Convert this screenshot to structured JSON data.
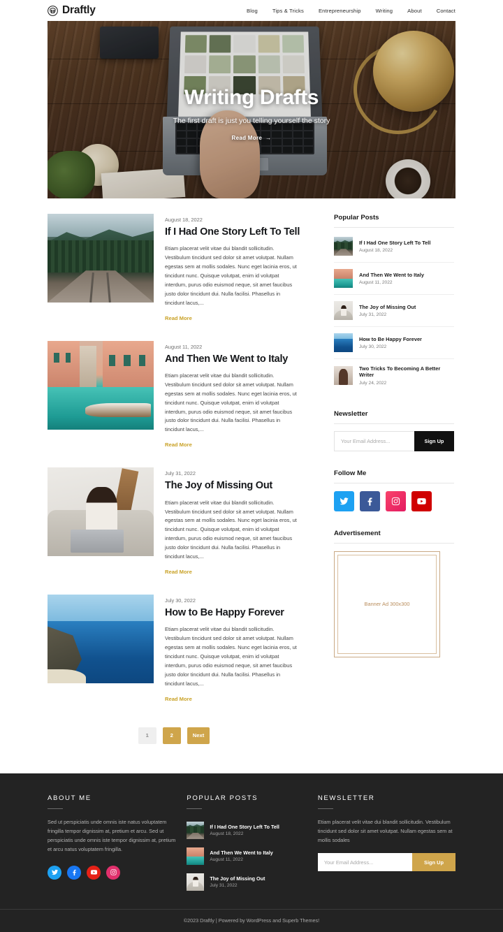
{
  "header": {
    "brand": "Draftly",
    "logo_icon": "shell-crown-circle-icon",
    "nav": [
      {
        "label": "Blog"
      },
      {
        "label": "Tips & Tricks"
      },
      {
        "label": "Entrepreneurship"
      },
      {
        "label": "Writing"
      },
      {
        "label": "About"
      },
      {
        "label": "Contact"
      }
    ]
  },
  "hero": {
    "title": "Writing Drafts",
    "subtitle": "The first draft is just you telling yourself the story",
    "cta": "Read More",
    "cta_icon": "arrow-right-icon"
  },
  "posts": [
    {
      "date": "August 18, 2022",
      "title": "If I Had One Story Left To Tell",
      "excerpt": "Etiam placerat velit vitae dui blandit sollicitudin. Vestibulum tincidunt sed dolor sit amet volutpat. Nullam egestas sem at mollis sodales. Nunc eget lacinia eros, ut tincidunt nunc. Quisque volutpat, enim id volutpat interdum, purus odio euismod neque, sit amet faucibus justo dolor tincidunt dui. Nulla facilisi. Phasellus in tincidunt lacus,...",
      "read_more": "Read More",
      "thumb": "railway-through-forest"
    },
    {
      "date": "August 11, 2022",
      "title": "And Then We Went to Italy",
      "excerpt": "Etiam placerat velit vitae dui blandit sollicitudin. Vestibulum tincidunt sed dolor sit amet volutpat. Nullam egestas sem at mollis sodales. Nunc eget lacinia eros, ut tincidunt nunc. Quisque volutpat, enim id volutpat interdum, purus odio euismod neque, sit amet faucibus justo dolor tincidunt dui. Nulla facilisi. Phasellus in tincidunt lacus,...",
      "read_more": "Read More",
      "thumb": "venice-canal"
    },
    {
      "date": "July 31, 2022",
      "title": "The Joy of Missing Out",
      "excerpt": "Etiam placerat velit vitae dui blandit sollicitudin. Vestibulum tincidunt sed dolor sit amet volutpat. Nullam egestas sem at mollis sodales. Nunc eget lacinia eros, ut tincidunt nunc. Quisque volutpat, enim id volutpat interdum, purus odio euismod neque, sit amet faucibus justo dolor tincidunt dui. Nulla facilisi. Phasellus in tincidunt lacus,...",
      "read_more": "Read More",
      "thumb": "woman-with-laptop"
    },
    {
      "date": "July 30, 2022",
      "title": "How to Be Happy Forever",
      "excerpt": "Etiam placerat velit vitae dui blandit sollicitudin. Vestibulum tincidunt sed dolor sit amet volutpat. Nullam egestas sem at mollis sodales. Nunc eget lacinia eros, ut tincidunt nunc. Quisque volutpat, enim id volutpat interdum, purus odio euismod neque, sit amet faucibus justo dolor tincidunt dui. Nulla facilisi. Phasellus in tincidunt lacus,...",
      "read_more": "Read More",
      "thumb": "coastal-cliff-ocean"
    }
  ],
  "pagination": [
    {
      "label": "1",
      "state": "current"
    },
    {
      "label": "2",
      "state": "link"
    },
    {
      "label": "Next",
      "state": "link"
    }
  ],
  "sidebar": {
    "popular_posts": {
      "title": "Popular Posts",
      "items": [
        {
          "title": "If I Had One Story Left To Tell",
          "date": "August 18, 2022",
          "thumb": "railway-through-forest"
        },
        {
          "title": "And Then We Went to Italy",
          "date": "August 11, 2022",
          "thumb": "venice-canal"
        },
        {
          "title": "The Joy of Missing Out",
          "date": "July 31, 2022",
          "thumb": "woman-with-laptop"
        },
        {
          "title": "How to Be Happy Forever",
          "date": "July 30, 2022",
          "thumb": "coastal-cliff-ocean"
        },
        {
          "title": "Two Tricks To Becoming A Better Writer",
          "date": "July 24, 2022",
          "thumb": "woman-portrait"
        }
      ]
    },
    "newsletter": {
      "title": "Newsletter",
      "placeholder": "Your Email Address...",
      "button": "Sign Up"
    },
    "follow": {
      "title": "Follow Me",
      "items": [
        {
          "name": "twitter",
          "color": "#1DA1F2"
        },
        {
          "name": "facebook",
          "color": "#3B5998"
        },
        {
          "name": "instagram",
          "color": "#F1336B"
        },
        {
          "name": "youtube",
          "color": "#D00000"
        }
      ]
    },
    "advertisement": {
      "title": "Advertisement",
      "placeholder": "Banner Ad 300x300"
    }
  },
  "footer": {
    "about": {
      "title": "ABOUT ME",
      "text": "Sed ut perspiciatis unde omnis iste natus voluptatem fringilla tempor dignissim at, pretium et arcu. Sed ut perspiciatis unde omnis iste tempor dignissim at, pretium et arcu natus voluptatem fringilla.",
      "socials": [
        {
          "name": "twitter",
          "color": "#1DA1F2"
        },
        {
          "name": "facebook",
          "color": "#1877F2"
        },
        {
          "name": "youtube",
          "color": "#E62117"
        },
        {
          "name": "instagram",
          "color": "#E1306C"
        }
      ]
    },
    "popular": {
      "title": "POPULAR POSTS",
      "items": [
        {
          "title": "If I Had One Story Left To Tell",
          "date": "August 18, 2022",
          "thumb": "railway-through-forest"
        },
        {
          "title": "And Then We Went to Italy",
          "date": "August 11, 2022",
          "thumb": "venice-canal"
        },
        {
          "title": "The Joy of Missing Out",
          "date": "July 31, 2022",
          "thumb": "woman-with-laptop"
        }
      ]
    },
    "newsletter": {
      "title": "NEWSLETTER",
      "text": "Etiam placerat velit vitae dui blandit sollicitudin. Vestibulum tincidunt sed dolor sit amet volutpat. Nullam egestas sem at mollis sodales",
      "placeholder": "Your Email Address...",
      "button": "Sign Up"
    },
    "copyright": "©2023 Draftly | Powered by WordPress and Superb Themes!"
  },
  "colors": {
    "accent_gold": "#cfa54b",
    "read_more": "#c9a227",
    "footer_bg": "#232323",
    "text": "#222222"
  }
}
